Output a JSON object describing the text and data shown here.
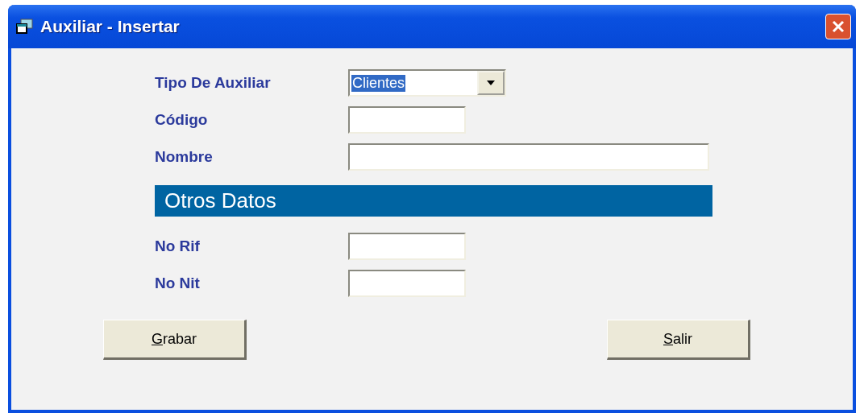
{
  "window": {
    "title": "Auxiliar - Insertar"
  },
  "fields": [
    {
      "label": "Tipo De Auxiliar",
      "kind": "combo",
      "value": "Clientes"
    },
    {
      "label": "Código",
      "kind": "text"
    },
    {
      "label": "Nombre",
      "kind": "text"
    }
  ],
  "section": {
    "title": "Otros Datos"
  },
  "other_fields": [
    {
      "label": "No Rif",
      "kind": "text"
    },
    {
      "label": "No Nit",
      "kind": "text"
    }
  ],
  "buttons": [
    {
      "label": "Grabar"
    },
    {
      "label": "Salir"
    }
  ]
}
